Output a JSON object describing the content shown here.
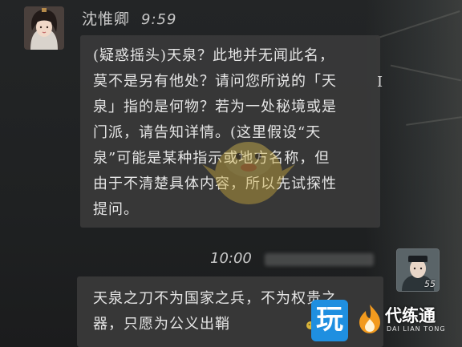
{
  "npc": {
    "name": "沈惟卿",
    "time": "9:59",
    "message": "(疑惑摇头)天泉？此地并无闻此名，莫不是另有他处？请问您所说的「天泉」指的是何物？若为一处秘境或是门派，请告知详情。(这里假设“天泉”可能是某种指示或地方名称，但由于不清楚具体内容，所以先试探性提问。",
    "lines": [
      "(疑惑摇头)天泉？此地并无闻此名，",
      "莫不是另有他处？请问您所说的「天",
      "泉」指的是何物？若为一处秘境或是",
      "门派，请告知详情。(这里假设“天",
      "泉”可能是某种指示或地方名称，但",
      "由于不清楚具体内容，所以先试探性",
      "提问。"
    ]
  },
  "player": {
    "time": "10:00",
    "level": "55",
    "lines": [
      "天泉之刀不为国家之兵，不为权贵之",
      "器，只愿为公义出鞘"
    ]
  },
  "text_cursor": "I",
  "watermarks": {
    "wan": "玩",
    "logo_title": "代练通",
    "logo_sub": "DAI LIAN TONG"
  },
  "colors": {
    "bubble": "#3a3a3a",
    "text": "#e6e6e6",
    "wan_blue": "#1f8fe0",
    "logo_orange": "#f29a1e"
  }
}
